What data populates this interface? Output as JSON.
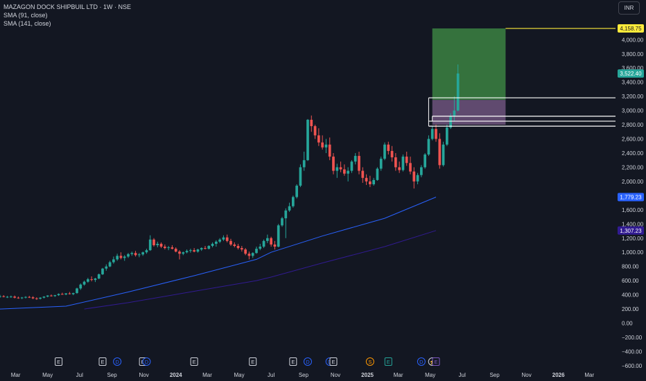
{
  "legend": {
    "symbol": "MAZAGON DOCK SHIPBUIL LTD · 1W · NSE",
    "sma1": "SMA (91, close)",
    "sma2": "SMA (141, close)"
  },
  "currency_button": "INR",
  "colors": {
    "up": "#26a69a",
    "down": "#ef5350",
    "sma1": "#2962ff",
    "sma2": "#311b92",
    "target_zone": "#4caf50",
    "stop_zone": "#7b5c8a",
    "level_line": "#ffeb3b",
    "box_line": "#ffffff",
    "background": "#131722"
  },
  "chart_data": {
    "type": "candlestick",
    "title": "",
    "y_ticks": [
      "4,000.00",
      "3,800.00",
      "3,600.00",
      "3,400.00",
      "3,200.00",
      "3,000.00",
      "2,800.00",
      "2,600.00",
      "2,400.00",
      "2,200.00",
      "2,000.00",
      "1,800.00",
      "1,600.00",
      "1,400.00",
      "1,200.00",
      "1,000.00",
      "800.00",
      "600.00",
      "400.00",
      "200.00",
      "0.00",
      "−200.00",
      "−400.00",
      "−600.00"
    ],
    "ylim": [
      -640,
      4560
    ],
    "x_ticks": [
      "Mar",
      "May",
      "Jul",
      "Sep",
      "Nov",
      "2024",
      "Mar",
      "May",
      "Jul",
      "Sep",
      "Nov",
      "2025",
      "Mar",
      "May",
      "Jul",
      "Sep",
      "Nov",
      "2026",
      "Mar"
    ],
    "x_range": [
      "2023-01-30",
      "2026-04-20"
    ],
    "price_badges": [
      {
        "label": "4,158.75",
        "value": 4158.75,
        "color": "#ffeb3b",
        "text_color": "#131722"
      },
      {
        "label": "3,522.40",
        "value": 3522.4,
        "color": "#26a69a",
        "text_color": "#ffffff"
      },
      {
        "label": "1,779.23",
        "value": 1779.23,
        "color": "#2962ff",
        "text_color": "#ffffff"
      },
      {
        "label": "1,307.23",
        "value": 1307.23,
        "color": "#311b92",
        "text_color": "#ffffff"
      }
    ],
    "event_markers": [
      {
        "date": "2023-05-22",
        "letter": "E"
      },
      {
        "date": "2023-08-14",
        "letter": "E"
      },
      {
        "date": "2023-09-11",
        "letter": "D"
      },
      {
        "date": "2023-10-30",
        "letter": "E"
      },
      {
        "date": "2023-11-06",
        "letter": "D"
      },
      {
        "date": "2024-02-05",
        "letter": "E"
      },
      {
        "date": "2024-05-27",
        "letter": "E"
      },
      {
        "date": "2024-08-12",
        "letter": "E"
      },
      {
        "date": "2024-09-09",
        "letter": "D"
      },
      {
        "date": "2024-10-21",
        "letter": "D"
      },
      {
        "date": "2024-10-28",
        "letter": "E"
      },
      {
        "date": "2025-01-06",
        "letter": "S"
      },
      {
        "date": "2025-02-10",
        "letter": "E"
      },
      {
        "date": "2025-04-14",
        "letter": "D"
      },
      {
        "date": "2025-05-05",
        "letter": "⚡"
      },
      {
        "date": "2025-05-12",
        "letter": "E"
      }
    ],
    "candles_start_date": "2023-01-30",
    "candles_interval_days": 7,
    "candles": [
      [
        375,
        400,
        360,
        380
      ],
      [
        380,
        395,
        365,
        370
      ],
      [
        370,
        385,
        355,
        372
      ],
      [
        372,
        390,
        360,
        375
      ],
      [
        375,
        390,
        350,
        360
      ],
      [
        360,
        375,
        345,
        355
      ],
      [
        355,
        370,
        340,
        362
      ],
      [
        362,
        380,
        350,
        370
      ],
      [
        370,
        385,
        355,
        365
      ],
      [
        365,
        380,
        340,
        350
      ],
      [
        350,
        365,
        330,
        345
      ],
      [
        345,
        365,
        335,
        360
      ],
      [
        360,
        380,
        350,
        375
      ],
      [
        375,
        395,
        365,
        390
      ],
      [
        390,
        405,
        375,
        382
      ],
      [
        382,
        400,
        372,
        395
      ],
      [
        395,
        420,
        385,
        412
      ],
      [
        412,
        430,
        400,
        405
      ],
      [
        405,
        425,
        395,
        420
      ],
      [
        420,
        440,
        405,
        410
      ],
      [
        410,
        430,
        395,
        425
      ],
      [
        425,
        500,
        415,
        490
      ],
      [
        490,
        560,
        470,
        545
      ],
      [
        545,
        600,
        530,
        585
      ],
      [
        585,
        640,
        570,
        620
      ],
      [
        620,
        660,
        590,
        610
      ],
      [
        610,
        640,
        580,
        630
      ],
      [
        630,
        700,
        620,
        690
      ],
      [
        690,
        780,
        680,
        770
      ],
      [
        770,
        830,
        740,
        800
      ],
      [
        800,
        880,
        790,
        860
      ],
      [
        860,
        940,
        840,
        900
      ],
      [
        900,
        980,
        880,
        950
      ],
      [
        950,
        1000,
        900,
        920
      ],
      [
        920,
        960,
        880,
        940
      ],
      [
        940,
        990,
        920,
        975
      ],
      [
        975,
        1010,
        950,
        990
      ],
      [
        990,
        1020,
        940,
        960
      ],
      [
        960,
        990,
        930,
        970
      ],
      [
        970,
        1010,
        950,
        1000
      ],
      [
        1000,
        1050,
        980,
        1030
      ],
      [
        1030,
        1240,
        1020,
        1180
      ],
      [
        1180,
        1200,
        1080,
        1100
      ],
      [
        1100,
        1150,
        1070,
        1120
      ],
      [
        1120,
        1140,
        1060,
        1080
      ],
      [
        1080,
        1110,
        1040,
        1060
      ],
      [
        1060,
        1090,
        1030,
        1070
      ],
      [
        1070,
        1100,
        1040,
        1050
      ],
      [
        1050,
        1070,
        1000,
        1010
      ],
      [
        1010,
        1030,
        900,
        980
      ],
      [
        980,
        1010,
        960,
        1000
      ],
      [
        1000,
        1040,
        985,
        1020
      ],
      [
        1020,
        1050,
        995,
        1030
      ],
      [
        1030,
        1060,
        1000,
        1010
      ],
      [
        1010,
        1050,
        995,
        1040
      ],
      [
        1040,
        1070,
        1020,
        1060
      ],
      [
        1060,
        1090,
        1040,
        1050
      ],
      [
        1050,
        1100,
        1040,
        1090
      ],
      [
        1090,
        1140,
        1070,
        1120
      ],
      [
        1120,
        1170,
        1080,
        1150
      ],
      [
        1150,
        1200,
        1130,
        1180
      ],
      [
        1180,
        1240,
        1160,
        1210
      ],
      [
        1210,
        1250,
        1140,
        1160
      ],
      [
        1160,
        1190,
        1090,
        1110
      ],
      [
        1110,
        1140,
        1070,
        1090
      ],
      [
        1090,
        1120,
        1040,
        1060
      ],
      [
        1060,
        1090,
        1010,
        1040
      ],
      [
        1040,
        1060,
        960,
        980
      ],
      [
        980,
        1010,
        900,
        950
      ],
      [
        950,
        1000,
        920,
        990
      ],
      [
        990,
        1080,
        980,
        1050
      ],
      [
        1050,
        1120,
        1030,
        1080
      ],
      [
        1080,
        1180,
        1060,
        1160
      ],
      [
        1160,
        1250,
        1130,
        1200
      ],
      [
        1200,
        1220,
        1080,
        1110
      ],
      [
        1110,
        1160,
        1040,
        1080
      ],
      [
        1080,
        1400,
        1070,
        1380
      ],
      [
        1380,
        1500,
        1360,
        1480
      ],
      [
        1480,
        1620,
        1200,
        1590
      ],
      [
        1590,
        1700,
        1570,
        1650
      ],
      [
        1650,
        1800,
        1630,
        1780
      ],
      [
        1780,
        1960,
        1760,
        1940
      ],
      [
        1940,
        2240,
        1920,
        2200
      ],
      [
        2200,
        2420,
        2150,
        2300
      ],
      [
        2300,
        2880,
        2290,
        2870
      ],
      [
        2870,
        2930,
        2700,
        2780
      ],
      [
        2780,
        2800,
        2600,
        2650
      ],
      [
        2650,
        2750,
        2500,
        2550
      ],
      [
        2550,
        2650,
        2450,
        2480
      ],
      [
        2480,
        2600,
        2400,
        2520
      ],
      [
        2520,
        2620,
        2300,
        2350
      ],
      [
        2350,
        2400,
        2100,
        2150
      ],
      [
        2150,
        2250,
        2050,
        2200
      ],
      [
        2200,
        2280,
        2130,
        2170
      ],
      [
        2170,
        2240,
        2080,
        2110
      ],
      [
        2110,
        2200,
        2000,
        2150
      ],
      [
        2150,
        2300,
        2120,
        2280
      ],
      [
        2280,
        2400,
        2240,
        2360
      ],
      [
        2360,
        2420,
        2100,
        2150
      ],
      [
        2150,
        2200,
        1980,
        2050
      ],
      [
        2050,
        2100,
        1950,
        2000
      ],
      [
        2000,
        2080,
        1920,
        1960
      ],
      [
        1960,
        2050,
        1940,
        2020
      ],
      [
        2020,
        2200,
        2010,
        2180
      ],
      [
        2180,
        2350,
        2150,
        2320
      ],
      [
        2320,
        2550,
        2300,
        2520
      ],
      [
        2520,
        2560,
        2380,
        2430
      ],
      [
        2430,
        2500,
        2280,
        2340
      ],
      [
        2340,
        2400,
        2150,
        2200
      ],
      [
        2200,
        2280,
        2120,
        2160
      ],
      [
        2160,
        2380,
        2140,
        2350
      ],
      [
        2350,
        2420,
        2220,
        2260
      ],
      [
        2260,
        2350,
        2100,
        2140
      ],
      [
        2140,
        2200,
        1900,
        2000
      ],
      [
        2000,
        2120,
        1960,
        2090
      ],
      [
        2090,
        2230,
        2060,
        2200
      ],
      [
        2200,
        2400,
        2180,
        2380
      ],
      [
        2380,
        2650,
        2360,
        2600
      ],
      [
        2600,
        2780,
        2580,
        2740
      ],
      [
        2740,
        2800,
        2560,
        2600
      ],
      [
        2600,
        2680,
        2180,
        2230
      ],
      [
        2230,
        2560,
        2210,
        2520
      ],
      [
        2520,
        2800,
        2500,
        2760
      ],
      [
        2760,
        2960,
        2740,
        2920
      ],
      [
        2920,
        3200,
        2850,
        3000
      ],
      [
        3000,
        3650,
        2990,
        3522.4
      ]
    ],
    "series": [
      {
        "name": "SMA (91, close)",
        "x": [
          "2023-01-30",
          "2023-06-05",
          "2023-10-02",
          "2024-02-05",
          "2024-06-03",
          "2024-07-01",
          "2024-10-07",
          "2025-02-03",
          "2025-05-12"
        ],
        "values": [
          200,
          240,
          440,
          670,
          900,
          1000,
          1230,
          1480,
          1779.23
        ]
      },
      {
        "name": "SMA (141, close)",
        "x": [
          "2023-07-10",
          "2023-10-02",
          "2024-02-05",
          "2024-06-03",
          "2024-07-01",
          "2024-10-07",
          "2025-02-03",
          "2025-05-12"
        ],
        "values": [
          200,
          290,
          450,
          600,
          650,
          850,
          1080,
          1307.23
        ]
      }
    ],
    "position_tool": {
      "start": "2025-05-05",
      "end": "2025-09-22",
      "entry": 3150,
      "target": 4158.75,
      "stop": 2800
    },
    "level_lines": [
      {
        "value": 4158.75,
        "from": "2025-09-22",
        "to": "axis"
      },
      {
        "value": 3180,
        "from": "2025-04-28",
        "to": "axis"
      },
      {
        "value": 2920,
        "from": "2025-05-05",
        "to": "axis"
      },
      {
        "value": 2850,
        "from": "2025-04-28",
        "to": "axis"
      },
      {
        "value": 2780,
        "from": "2025-04-28",
        "to": "axis"
      }
    ],
    "grid": false,
    "legend_position": "top-left"
  }
}
